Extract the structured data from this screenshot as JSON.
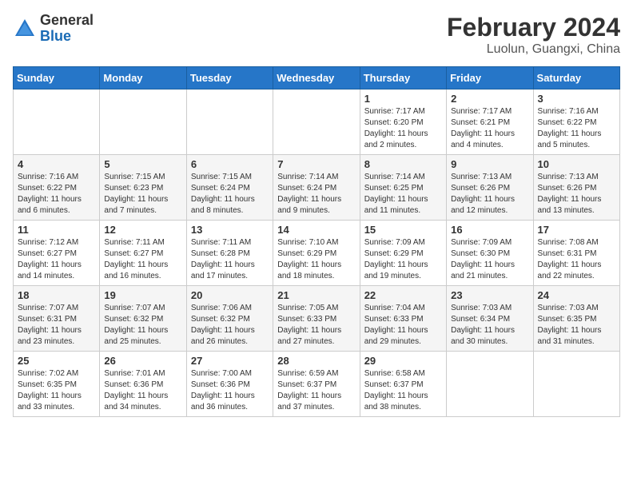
{
  "logo": {
    "general": "General",
    "blue": "Blue"
  },
  "title": {
    "month_year": "February 2024",
    "location": "Luolun, Guangxi, China"
  },
  "weekdays": [
    "Sunday",
    "Monday",
    "Tuesday",
    "Wednesday",
    "Thursday",
    "Friday",
    "Saturday"
  ],
  "weeks": [
    [
      {
        "day": "",
        "info": ""
      },
      {
        "day": "",
        "info": ""
      },
      {
        "day": "",
        "info": ""
      },
      {
        "day": "",
        "info": ""
      },
      {
        "day": "1",
        "info": "Sunrise: 7:17 AM\nSunset: 6:20 PM\nDaylight: 11 hours and 2 minutes."
      },
      {
        "day": "2",
        "info": "Sunrise: 7:17 AM\nSunset: 6:21 PM\nDaylight: 11 hours and 4 minutes."
      },
      {
        "day": "3",
        "info": "Sunrise: 7:16 AM\nSunset: 6:22 PM\nDaylight: 11 hours and 5 minutes."
      }
    ],
    [
      {
        "day": "4",
        "info": "Sunrise: 7:16 AM\nSunset: 6:22 PM\nDaylight: 11 hours and 6 minutes."
      },
      {
        "day": "5",
        "info": "Sunrise: 7:15 AM\nSunset: 6:23 PM\nDaylight: 11 hours and 7 minutes."
      },
      {
        "day": "6",
        "info": "Sunrise: 7:15 AM\nSunset: 6:24 PM\nDaylight: 11 hours and 8 minutes."
      },
      {
        "day": "7",
        "info": "Sunrise: 7:14 AM\nSunset: 6:24 PM\nDaylight: 11 hours and 9 minutes."
      },
      {
        "day": "8",
        "info": "Sunrise: 7:14 AM\nSunset: 6:25 PM\nDaylight: 11 hours and 11 minutes."
      },
      {
        "day": "9",
        "info": "Sunrise: 7:13 AM\nSunset: 6:26 PM\nDaylight: 11 hours and 12 minutes."
      },
      {
        "day": "10",
        "info": "Sunrise: 7:13 AM\nSunset: 6:26 PM\nDaylight: 11 hours and 13 minutes."
      }
    ],
    [
      {
        "day": "11",
        "info": "Sunrise: 7:12 AM\nSunset: 6:27 PM\nDaylight: 11 hours and 14 minutes."
      },
      {
        "day": "12",
        "info": "Sunrise: 7:11 AM\nSunset: 6:27 PM\nDaylight: 11 hours and 16 minutes."
      },
      {
        "day": "13",
        "info": "Sunrise: 7:11 AM\nSunset: 6:28 PM\nDaylight: 11 hours and 17 minutes."
      },
      {
        "day": "14",
        "info": "Sunrise: 7:10 AM\nSunset: 6:29 PM\nDaylight: 11 hours and 18 minutes."
      },
      {
        "day": "15",
        "info": "Sunrise: 7:09 AM\nSunset: 6:29 PM\nDaylight: 11 hours and 19 minutes."
      },
      {
        "day": "16",
        "info": "Sunrise: 7:09 AM\nSunset: 6:30 PM\nDaylight: 11 hours and 21 minutes."
      },
      {
        "day": "17",
        "info": "Sunrise: 7:08 AM\nSunset: 6:31 PM\nDaylight: 11 hours and 22 minutes."
      }
    ],
    [
      {
        "day": "18",
        "info": "Sunrise: 7:07 AM\nSunset: 6:31 PM\nDaylight: 11 hours and 23 minutes."
      },
      {
        "day": "19",
        "info": "Sunrise: 7:07 AM\nSunset: 6:32 PM\nDaylight: 11 hours and 25 minutes."
      },
      {
        "day": "20",
        "info": "Sunrise: 7:06 AM\nSunset: 6:32 PM\nDaylight: 11 hours and 26 minutes."
      },
      {
        "day": "21",
        "info": "Sunrise: 7:05 AM\nSunset: 6:33 PM\nDaylight: 11 hours and 27 minutes."
      },
      {
        "day": "22",
        "info": "Sunrise: 7:04 AM\nSunset: 6:33 PM\nDaylight: 11 hours and 29 minutes."
      },
      {
        "day": "23",
        "info": "Sunrise: 7:03 AM\nSunset: 6:34 PM\nDaylight: 11 hours and 30 minutes."
      },
      {
        "day": "24",
        "info": "Sunrise: 7:03 AM\nSunset: 6:35 PM\nDaylight: 11 hours and 31 minutes."
      }
    ],
    [
      {
        "day": "25",
        "info": "Sunrise: 7:02 AM\nSunset: 6:35 PM\nDaylight: 11 hours and 33 minutes."
      },
      {
        "day": "26",
        "info": "Sunrise: 7:01 AM\nSunset: 6:36 PM\nDaylight: 11 hours and 34 minutes."
      },
      {
        "day": "27",
        "info": "Sunrise: 7:00 AM\nSunset: 6:36 PM\nDaylight: 11 hours and 36 minutes."
      },
      {
        "day": "28",
        "info": "Sunrise: 6:59 AM\nSunset: 6:37 PM\nDaylight: 11 hours and 37 minutes."
      },
      {
        "day": "29",
        "info": "Sunrise: 6:58 AM\nSunset: 6:37 PM\nDaylight: 11 hours and 38 minutes."
      },
      {
        "day": "",
        "info": ""
      },
      {
        "day": "",
        "info": ""
      }
    ]
  ]
}
